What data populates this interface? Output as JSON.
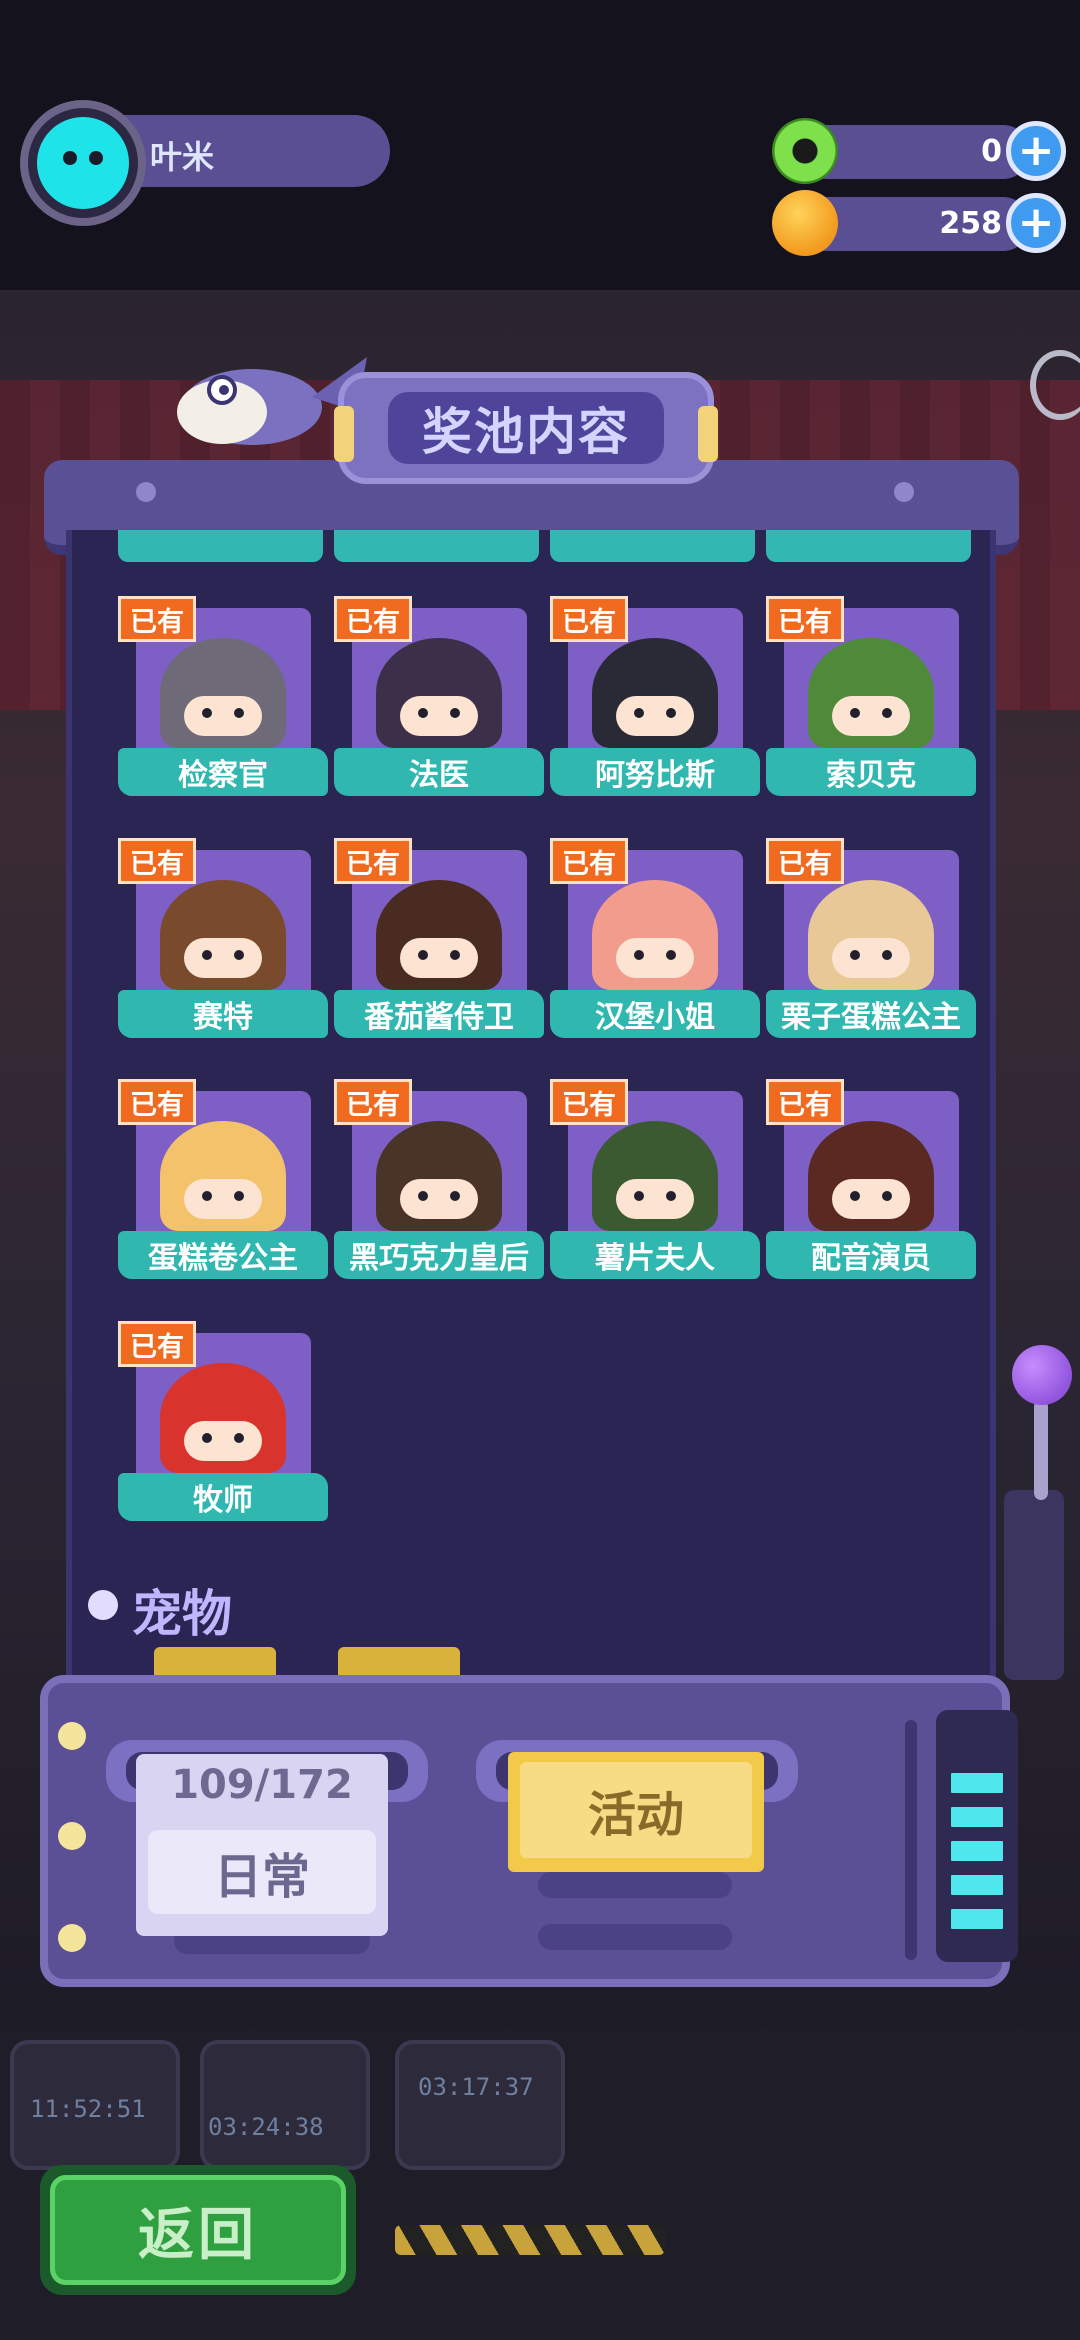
{
  "header": {
    "player_name": "叶米",
    "currency": [
      {
        "icon": "donut-coin-icon",
        "value": "0"
      },
      {
        "icon": "planet-coin-icon",
        "value": "258"
      }
    ]
  },
  "modal": {
    "title": "奖池内容",
    "owned_badge": "已有",
    "characters": [
      {
        "name": "检察官",
        "color": "#6e6a78"
      },
      {
        "name": "法医",
        "color": "#3b2f4a"
      },
      {
        "name": "阿努比斯",
        "color": "#2a2a36"
      },
      {
        "name": "索贝克",
        "color": "#4f8a3a"
      },
      {
        "name": "赛特",
        "color": "#7a4a2c"
      },
      {
        "name": "番茄酱侍卫",
        "color": "#4a2b22"
      },
      {
        "name": "汉堡小姐",
        "color": "#f29c8e"
      },
      {
        "name": "栗子蛋糕公主",
        "color": "#e8c896"
      },
      {
        "name": "蛋糕卷公主",
        "color": "#f3c26a"
      },
      {
        "name": "黑巧克力皇后",
        "color": "#4a3428"
      },
      {
        "name": "薯片夫人",
        "color": "#3c5a32"
      },
      {
        "name": "配音演员",
        "color": "#5a2a22"
      },
      {
        "name": "牧师",
        "color": "#d8332c"
      }
    ],
    "section_label": "宠物"
  },
  "console": {
    "daily_count": "109/172",
    "daily_label": "日常",
    "event_label": "活动"
  },
  "back_label": "返回",
  "background_timers": [
    "11:52:51",
    "03:24:38",
    "03:17:37"
  ]
}
